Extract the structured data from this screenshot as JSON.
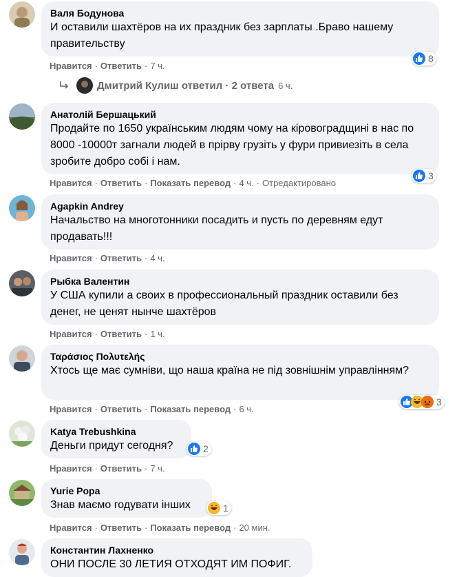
{
  "labels": {
    "like": "Нравится",
    "reply": "Ответить",
    "translate": "Показать перевод",
    "edited": "Отредактировано",
    "sep": "·"
  },
  "colors": {
    "bubble_bg": "#f0f2f5",
    "secondary_text": "#65676b",
    "like_blue": "#1877f2",
    "haha_yellow": "#f7b928"
  },
  "comments": [
    {
      "author": "Валя Бодунова",
      "text": "И оставили шахтёров на их праздник без зарплаты .Браво нашему правительству",
      "reaction_count": "8",
      "time": "7 ч."
    },
    {
      "author": "Анатолій Бершацький",
      "text": "Продайте по 1650 українським людям чому на кіровоградщині в нас по 8000 -10000т загнали людей в прірву грузіть у фури привиезіть в села зробите добро собі і нам.",
      "reaction_count": "3",
      "time": "4 ч."
    },
    {
      "author": "Agapkin Andrey",
      "text": "Начальство на многотонники посадить и пусть по деревням едут продавать!!!",
      "time": "4 ч."
    },
    {
      "author": "Рыбка Валентин",
      "text": "У США купили а своих в профессиональный праздник оставили без денег, не ценят нынче шахтёров",
      "time": "1 ч."
    },
    {
      "author": "Ταράσιος Πολυτελής",
      "text": "Хтось ще має сумніви, що наша країна не під зовнішнім управлінням?",
      "reaction_count": "3",
      "time": "6 ч."
    },
    {
      "author": "Katya Trebushkina",
      "text": "Деньги придут сегодня?",
      "reaction_count": "2",
      "time": "7 ч."
    },
    {
      "author": "Yurie Popa",
      "text": "Знав маємо годувати інших",
      "reaction_count": "1",
      "time": "20 мин."
    },
    {
      "author": "Константин Лахненко",
      "text": "ОНИ ПОСЛЕ 30 ЛЕТИЯ ОТХОДЯТ ИМ ПОФИГ."
    }
  ],
  "replies": {
    "text": "Дмитрий Кулиш ответил · 2 ответа",
    "time": "6 ч."
  }
}
